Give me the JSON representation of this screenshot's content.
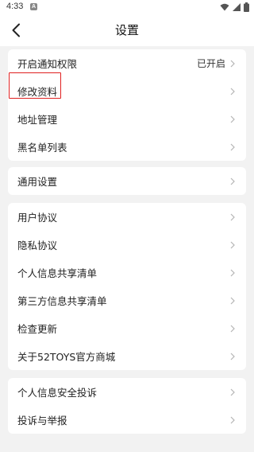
{
  "status_bar": {
    "time": "4:33",
    "notification_icon": "a-letter-icon",
    "wifi_icon": "wifi-icon",
    "signal_icon": "cell-signal-icon",
    "battery_icon": "battery-icon"
  },
  "header": {
    "title": "设置",
    "back_icon": "chevron-left-icon"
  },
  "groups": [
    {
      "items": [
        {
          "label": "开启通知权限",
          "value": "已开启"
        },
        {
          "label": "修改资料",
          "value": ""
        },
        {
          "label": "地址管理",
          "value": ""
        },
        {
          "label": "黑名单列表",
          "value": ""
        }
      ]
    },
    {
      "items": [
        {
          "label": "通用设置",
          "value": ""
        }
      ]
    },
    {
      "items": [
        {
          "label": "用户协议",
          "value": ""
        },
        {
          "label": "隐私协议",
          "value": ""
        },
        {
          "label": "个人信息共享清单",
          "value": ""
        },
        {
          "label": "第三方信息共享清单",
          "value": ""
        },
        {
          "label": "检查更新",
          "value": ""
        },
        {
          "label": "关于52TOYS官方商城",
          "value": ""
        }
      ]
    },
    {
      "items": [
        {
          "label": "个人信息安全投诉",
          "value": ""
        },
        {
          "label": "投诉与举报",
          "value": ""
        }
      ]
    }
  ],
  "colors": {
    "background": "#f2f2f2",
    "card": "#ffffff",
    "highlight": "#e02020",
    "chevron": "#b5b5b5"
  }
}
